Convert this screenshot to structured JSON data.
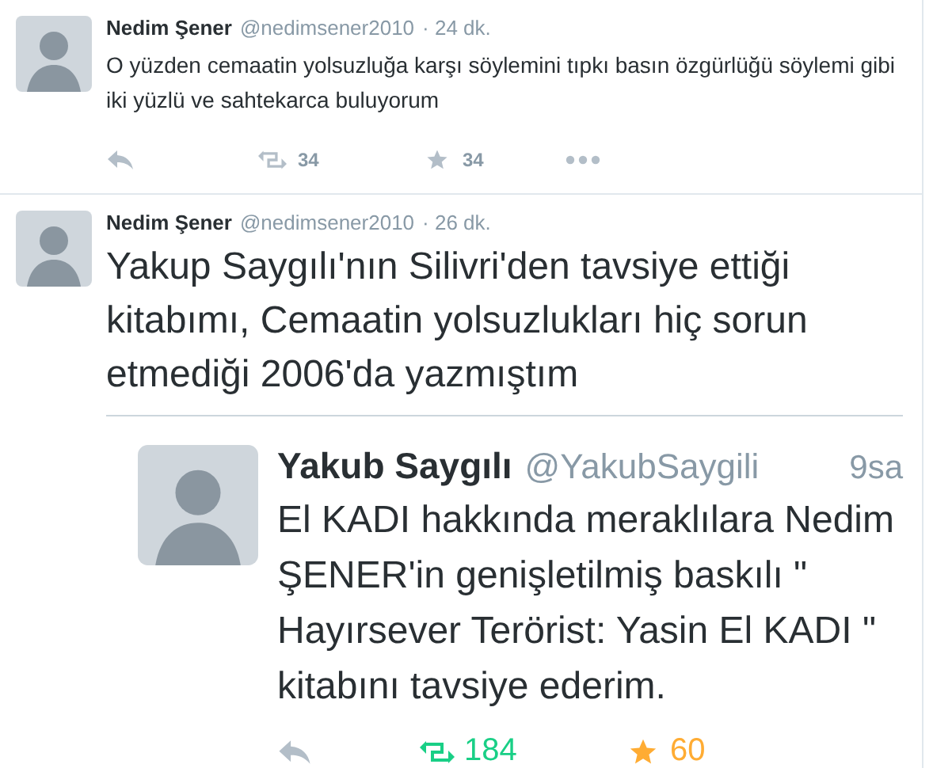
{
  "tweets": [
    {
      "kind": "plain",
      "author": "Nedim Şener",
      "handle": "@nedimsener2010",
      "time": "· 24 dk.",
      "text": "O yüzden cemaatin yolsuzluğa karşı söylemini tıpkı basın özgürlüğü söylemi gibi iki yüzlü ve sahtekarca buluyorum",
      "actions": {
        "retweets": "34",
        "favorites": "34",
        "retweeted": false,
        "favorited": false
      }
    },
    {
      "kind": "large",
      "author": "Nedim Şener",
      "handle": "@nedimsener2010",
      "time": "· 26 dk.",
      "text": "Yakup Saygılı'nın Silivri'den tavsiye ettiği kitabımı, Cemaatin yolsuzlukları hiç sorun etmediği 2006'da yazmıştım",
      "attachment": {
        "author": "Yakub Saygılı",
        "handle": "@YakubSaygili",
        "time": "9sa",
        "text": "El KADI hakkında meraklılara Nedim ŞENER'in genişletilmiş baskılı \" Hayırsever Terörist: Yasin El KADI \" kitabını tavsiye ederim.",
        "actions": {
          "retweets": "184",
          "favorites": "60",
          "retweeted": true,
          "favorited": true
        }
      }
    }
  ]
}
